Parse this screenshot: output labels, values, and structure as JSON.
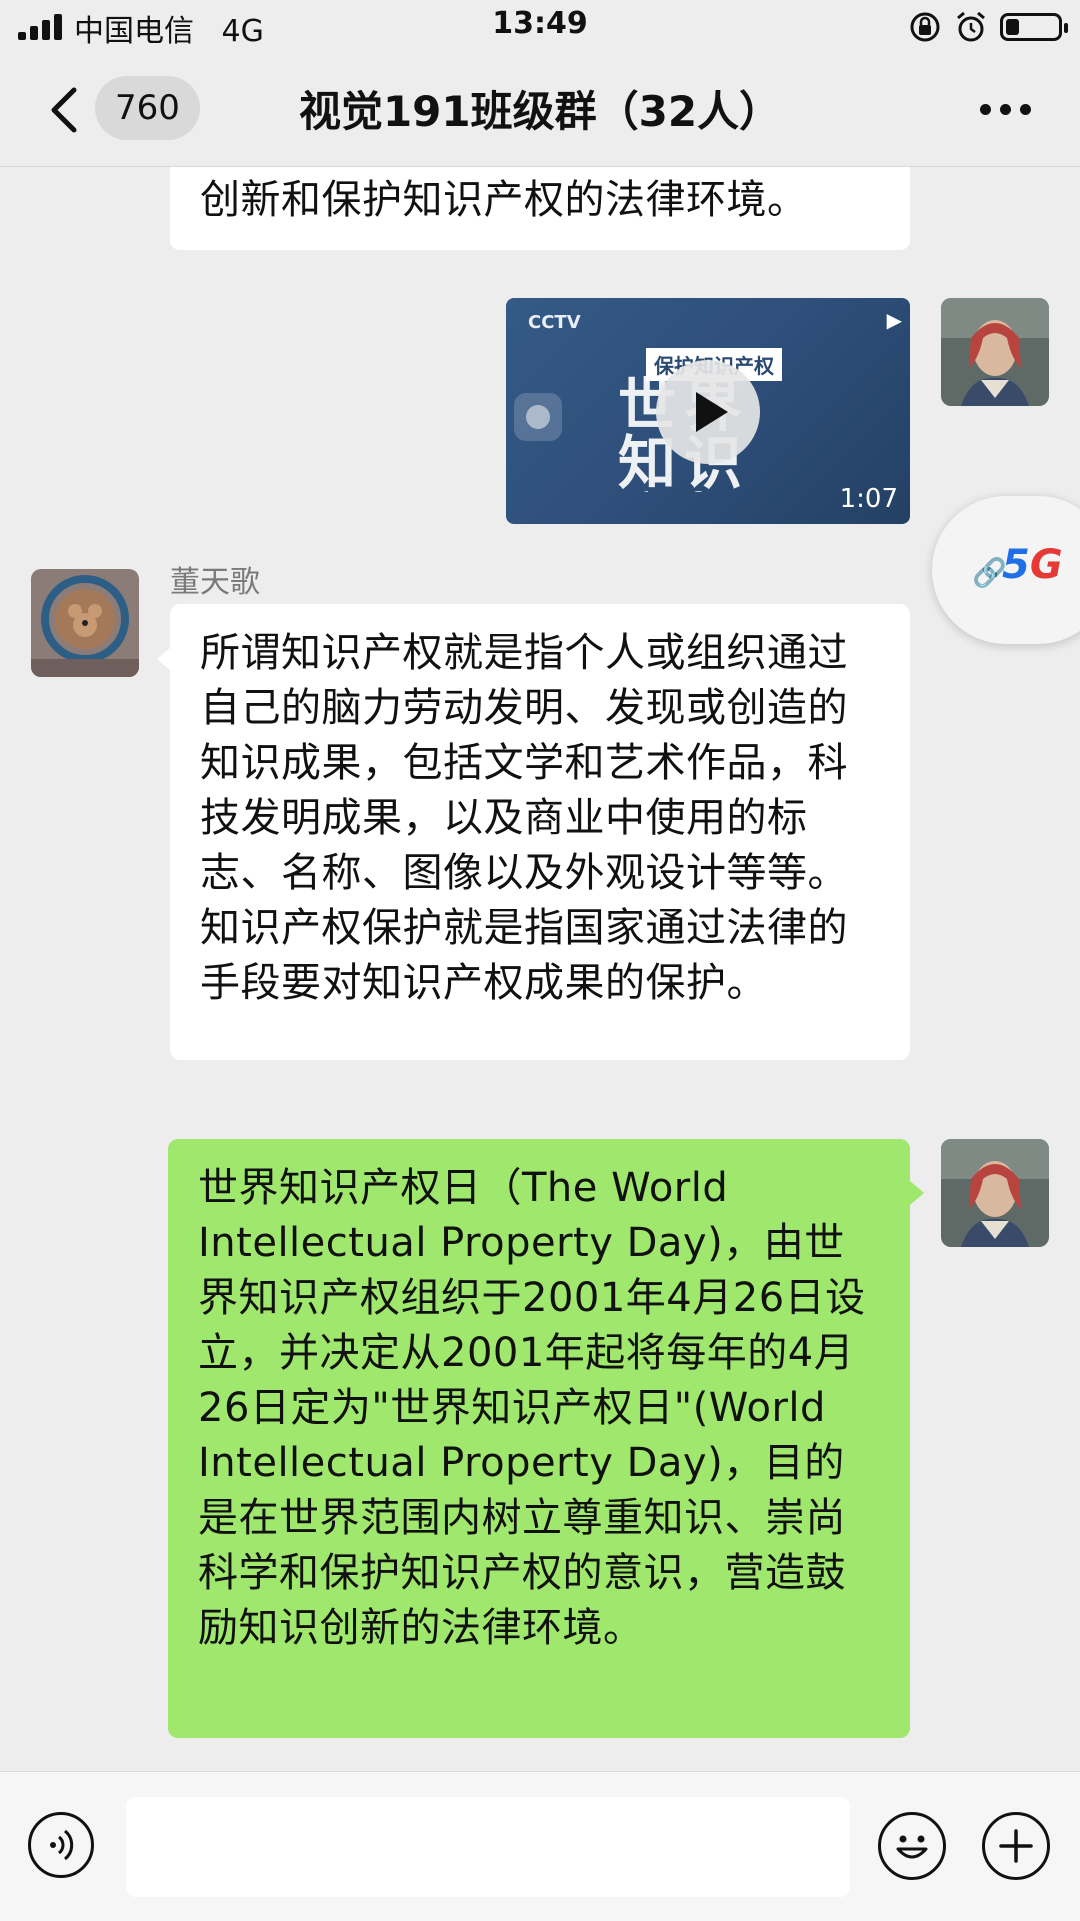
{
  "status_bar": {
    "carrier": "中国电信",
    "network": "4G",
    "time": "13:49",
    "battery_level": 0.25,
    "icons": [
      "signal-icon",
      "rotation-lock-icon",
      "alarm-icon",
      "battery-icon"
    ]
  },
  "nav": {
    "back_icon": "chevron-left-icon",
    "unread_count": "760",
    "title": "视觉191班级群（32人）",
    "more_icon": "more-dots-icon"
  },
  "messages": [
    {
      "type": "text",
      "side": "left",
      "text": "创新和保护知识产权的法律环境。"
    },
    {
      "type": "video",
      "side": "right",
      "thumb_logo": "CCTV",
      "thumb_badge": "保护知识产权",
      "thumb_big": "世界知识产权日",
      "duration": "1:07"
    },
    {
      "type": "text",
      "side": "left",
      "sender": "董天歌",
      "text": "所谓知识产权就是指个人或组织通过自己的脑力劳动发明、发现或创造的知识成果，包括文学和艺术作品，科技发明成果，以及商业中使用的标志、名称、图像以及外观设计等等。知识产权保护就是指国家通过法律的手段要对知识产权成果的保护。"
    },
    {
      "type": "text",
      "side": "right",
      "text": "世界知识产权日（The World Intellectual Property Day)，由世界知识产权组织于2001年4月26日设立，并决定从2001年起将每年的4月26日定为\"世界知识产权日\"(World Intellectual Property Day)，目的是在世界范围内树立尊重知识、崇尚科学和保护知识产权的意识，营造鼓励知识创新的法律环境。"
    }
  ],
  "floating_widget": {
    "label": "5G",
    "icon": "link-icon"
  },
  "input_bar": {
    "placeholder": "",
    "icons": [
      "voice-icon",
      "emoji-icon",
      "plus-icon"
    ]
  },
  "colors": {
    "background": "#ededed",
    "sent_bubble": "#a0e86d",
    "received_bubble": "#ffffff",
    "accent_5g_blue": "#1f6fe6",
    "accent_5g_red": "#e53935"
  }
}
